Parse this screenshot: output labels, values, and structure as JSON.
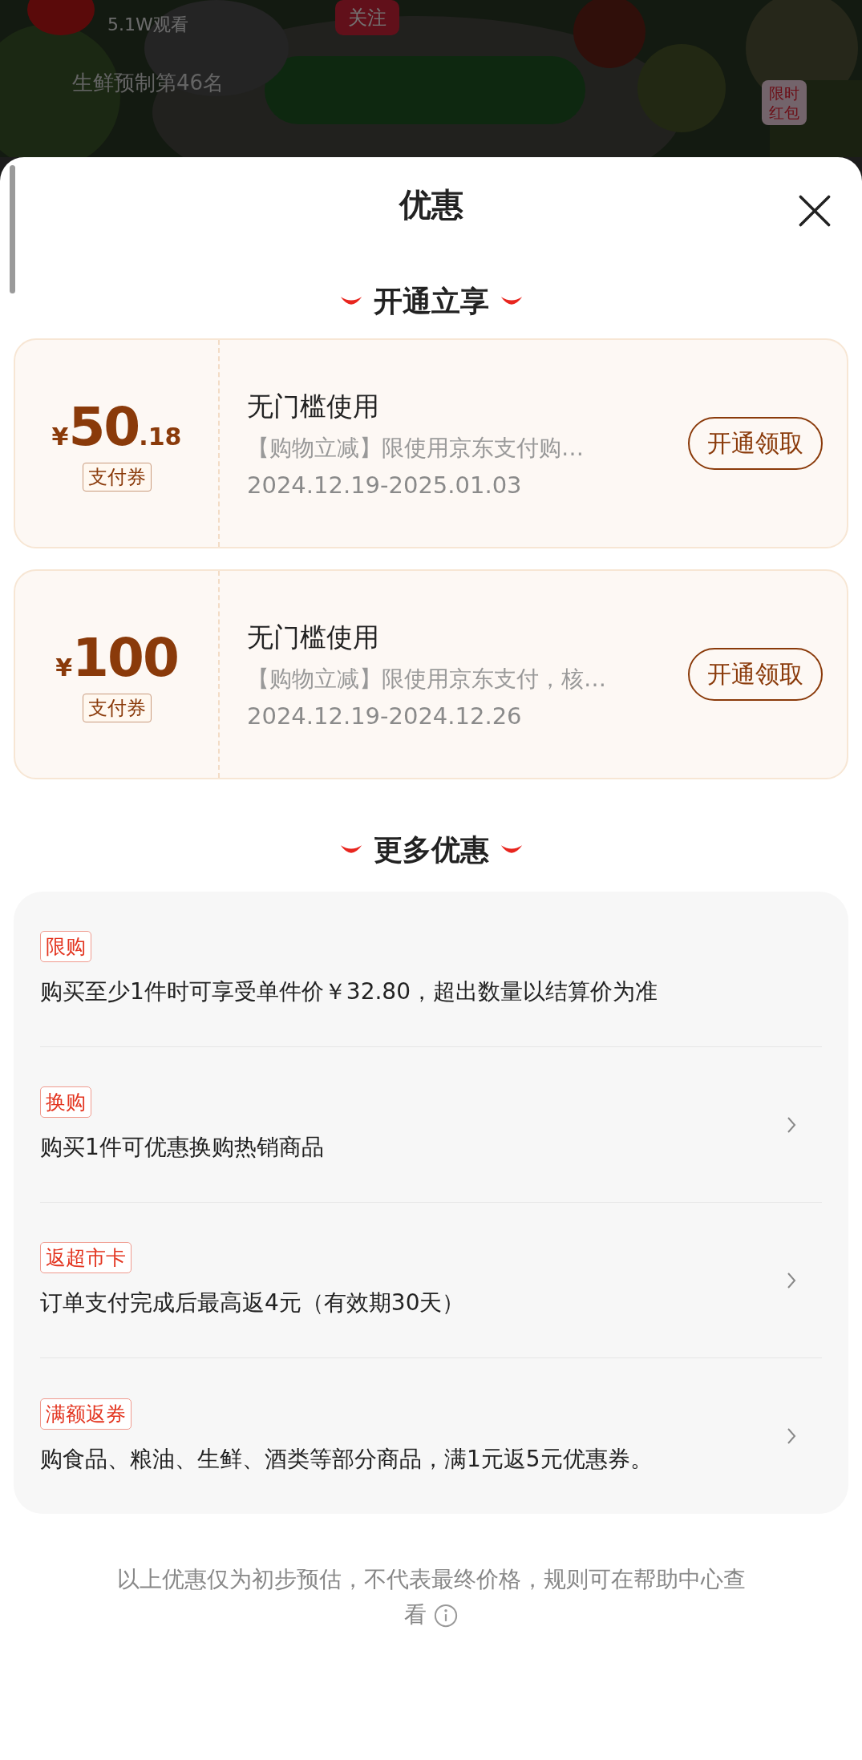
{
  "background": {
    "kind": "picture",
    "viewers": "5.1W观看",
    "follow_button": "关注",
    "rank": "生鲜预制第46名",
    "red_packet": "限时红包"
  },
  "sheet": {
    "title": "优惠"
  },
  "sections": [
    {
      "title": "开通立享",
      "coupons": [
        {
          "amount": "50",
          "decimal": ".18",
          "currency": "¥",
          "tag": "支付券",
          "name": "无门槛使用",
          "desc": "【购物立减】限使用京东支付购…",
          "dates": "2024.12.19-2025.01.03",
          "button": "开通领取"
        },
        {
          "amount": "100",
          "currency": "¥",
          "tag": "支付券",
          "name": "无门槛使用",
          "desc": "【购物立减】限使用京东支付，核…",
          "dates": "2024.12.19-2024.12.26",
          "button": "开通领取"
        }
      ]
    },
    {
      "title": "更多优惠",
      "offers": [
        {
          "tag": "限购",
          "text": "购买至少1件时可享受单件价￥32.80，超出数量以结算价为准",
          "arrow": false
        },
        {
          "tag": "换购",
          "text": "购买1件可优惠换购热销商品",
          "arrow": true
        },
        {
          "tag": "返超市卡",
          "text": "订单支付完成后最高返4元（有效期30天）",
          "arrow": true
        },
        {
          "tag": "满额返券",
          "text": "购食品、粮油、生鲜、酒类等部分商品，满1元返5元优惠券。",
          "arrow": true
        }
      ]
    }
  ],
  "footer": {
    "note": "以上优惠仅为初步预估，不代表最终价格，规则可在帮助中心查看"
  }
}
